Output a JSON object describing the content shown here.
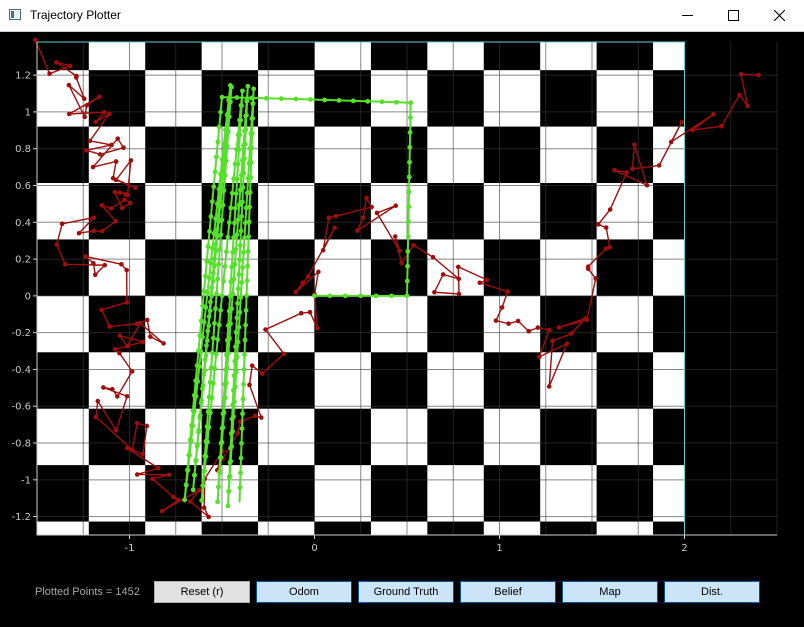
{
  "window": {
    "title": "Trajectory Plotter",
    "icon": "app-window-icon",
    "controls": [
      "minimize-icon",
      "maximize-icon",
      "close-icon"
    ]
  },
  "plot": {
    "xlim": [
      -1.5,
      2.5
    ],
    "ylim": [
      -1.3,
      1.38
    ],
    "x_ticks": [
      "-1",
      "0",
      "1",
      "2"
    ],
    "y_ticks": [
      "1.2",
      "1",
      "0.8",
      "0.6",
      "0.4",
      "0.2",
      "0",
      "-0.2",
      "-0.4",
      "-0.6",
      "-0.8",
      "-1",
      "-1.2"
    ],
    "map_extent": {
      "x": [
        -1.5,
        2.0
      ],
      "y": [
        -1.3,
        1.38
      ]
    },
    "checker_cell": 0.305,
    "colors": {
      "background": "#000000",
      "map_light": "#ffffff",
      "map_dark": "#000000",
      "map_border": "#5fd3d3",
      "grid": "#3a3a3a",
      "ground_truth": "#55e02a",
      "odom": "#a00d0d",
      "axis_text": "#c8c8c8"
    },
    "ground_truth_path": [
      [
        0,
        0
      ],
      [
        0.5,
        0
      ],
      [
        0.52,
        1.05
      ],
      [
        -0.5,
        1.08
      ],
      [
        -0.7,
        -1.05
      ],
      [
        -0.4,
        -1.15
      ],
      [
        -0.3,
        1.12
      ],
      [
        -0.45,
        1.0
      ],
      [
        -0.75,
        -1.1
      ]
    ],
    "odom_path": [
      [
        -1.4,
        1.3
      ],
      [
        -1.2,
        0.9
      ],
      [
        -1.0,
        0.6
      ],
      [
        -1.3,
        0.3
      ],
      [
        -0.9,
        -0.2
      ],
      [
        -1.1,
        -0.7
      ],
      [
        -0.7,
        -1.2
      ],
      [
        -0.2,
        -0.3
      ],
      [
        0.2,
        0.5
      ],
      [
        0.8,
        0.1
      ],
      [
        1.3,
        -0.4
      ],
      [
        1.6,
        0.6
      ],
      [
        2.4,
        1.2
      ]
    ]
  },
  "status": {
    "text": "Plotted Points = 1452"
  },
  "buttons": {
    "reset": "Reset (r)",
    "odom": "Odom",
    "ground_truth": "Ground Truth",
    "belief": "Belief",
    "map": "Map",
    "dist": "Dist."
  }
}
